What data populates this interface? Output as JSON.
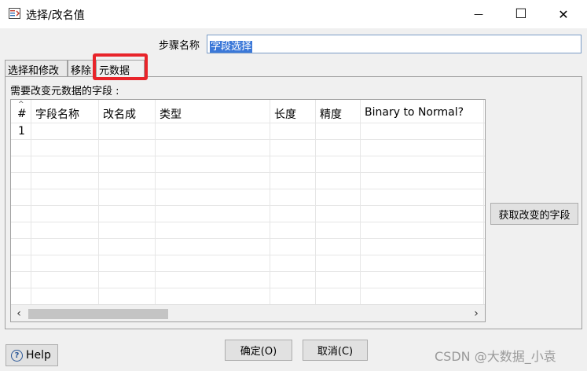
{
  "window": {
    "title": "选择/改名值",
    "minimize_glyph": "—",
    "maximize_glyph": "☐",
    "close_glyph": "✕"
  },
  "step": {
    "label": "步骤名称",
    "value": "字段选择"
  },
  "tabs": [
    {
      "label": "选择和修改"
    },
    {
      "label": "移除"
    },
    {
      "label": "元数据"
    }
  ],
  "active_tab": "元数据",
  "meta": {
    "fields_label": "需要改变元数据的字段 :"
  },
  "grid": {
    "sort_caret": "^",
    "columns": [
      "#",
      "字段名称",
      "改名成",
      "类型",
      "长度",
      "精度",
      "Binary to Normal?"
    ],
    "rows": [
      [
        "1",
        "",
        "",
        "",
        "",
        "",
        ""
      ]
    ],
    "scroll_left": "‹",
    "scroll_right": "›"
  },
  "buttons": {
    "get_fields": "获取改变的字段",
    "ok": "确定(O)",
    "cancel": "取消(C)",
    "help": "Help",
    "help_glyph": "?"
  },
  "watermark": "CSDN @大数据_小袁",
  "colors": {
    "highlight": "#e8242a",
    "selection": "#3b78d8"
  }
}
